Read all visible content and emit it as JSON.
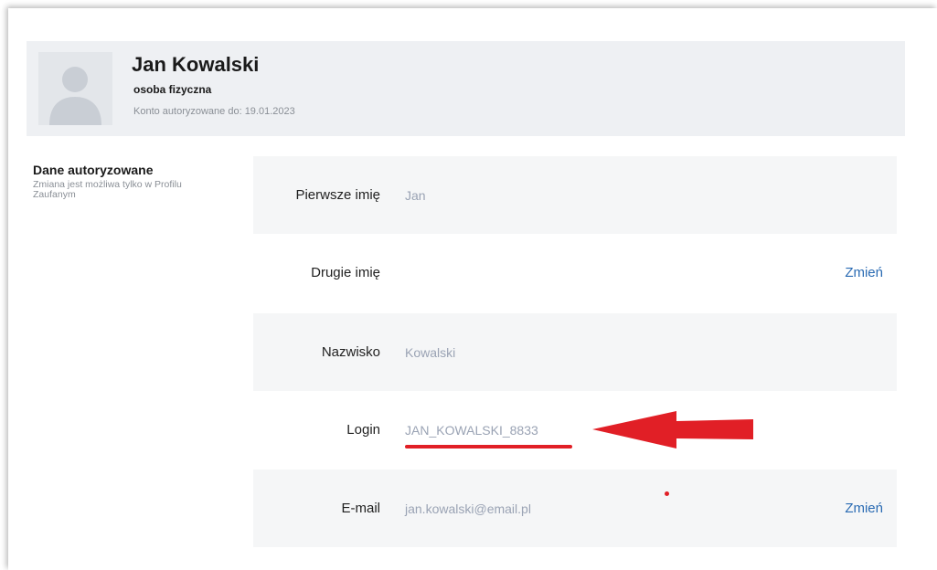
{
  "profile": {
    "name": "Jan Kowalski",
    "type": "osoba fizyczna",
    "authorized_until": "Konto autoryzowane do: 19.01.2023"
  },
  "section": {
    "title": "Dane autoryzowane",
    "description": "Zmiana jest możliwa tylko w Profilu Zaufanym"
  },
  "fields": {
    "first_name": {
      "label": "Pierwsze imię",
      "value": "Jan"
    },
    "second_name": {
      "label": "Drugie imię",
      "value": "",
      "action": "Zmień"
    },
    "surname": {
      "label": "Nazwisko",
      "value": "Kowalski"
    },
    "login": {
      "label": "Login",
      "value": "JAN_KOWALSKI_8833"
    },
    "email": {
      "label": "E-mail",
      "value": "jan.kowalski@email.pl",
      "action": "Zmień"
    }
  },
  "colors": {
    "header_bg": "#eef0f3",
    "row_shaded_bg": "#f5f6f7",
    "value_text": "#9aa3b4",
    "link": "#2a6bb3",
    "annotation_red": "#e11f26"
  },
  "annotation": {
    "icon": "red-arrow-icon",
    "underline": true
  }
}
